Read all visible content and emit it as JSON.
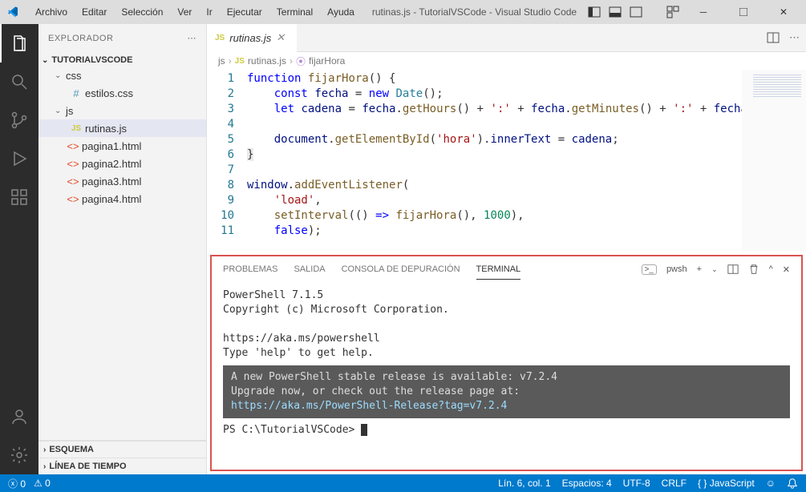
{
  "titlebar": {
    "menu": [
      "Archivo",
      "Editar",
      "Selección",
      "Ver",
      "Ir",
      "Ejecutar",
      "Terminal",
      "Ayuda"
    ],
    "title": "rutinas.js - TutorialVSCode - Visual Studio Code"
  },
  "sidebar": {
    "header": "EXPLORADOR",
    "project": "TUTORIALVSCODE",
    "folders": {
      "css": {
        "name": "css",
        "files": [
          "estilos.css"
        ]
      },
      "js": {
        "name": "js",
        "files": [
          "rutinas.js"
        ]
      }
    },
    "rootFiles": [
      "pagina1.html",
      "pagina2.html",
      "pagina3.html",
      "pagina4.html"
    ],
    "collapsed": [
      "ESQUEMA",
      "LÍNEA DE TIEMPO"
    ]
  },
  "tabs": {
    "active": {
      "icon": "JS",
      "name": "rutinas.js"
    }
  },
  "breadcrumbs": {
    "parts": [
      "js",
      "rutinas.js",
      "fijarHora"
    ],
    "icons": [
      "",
      "JS",
      "fn"
    ]
  },
  "code": {
    "lines": [
      1,
      2,
      3,
      4,
      5,
      6,
      7,
      8,
      9,
      10,
      11
    ]
  },
  "panel": {
    "tabs": [
      "PROBLEMAS",
      "SALIDA",
      "CONSOLA DE DEPURACIÓN",
      "TERMINAL"
    ],
    "active": "TERMINAL",
    "shell": "pwsh",
    "lines": {
      "l1": "PowerShell 7.1.5",
      "l2": "Copyright (c) Microsoft Corporation.",
      "l3": "https://aka.ms/powershell",
      "l4": "Type 'help' to get help.",
      "banner1": "A new PowerShell stable release is available: v7.2.4",
      "banner2": "Upgrade now, or check out the release page at:",
      "banner3": "  https://aka.ms/PowerShell-Release?tag=v7.2.4",
      "prompt": "PS C:\\TutorialVSCode> "
    }
  },
  "statusbar": {
    "errors": "0",
    "warnings": "0",
    "position": "Lín. 6, col. 1",
    "spaces": "Espacios: 4",
    "encoding": "UTF-8",
    "eol": "CRLF",
    "language": "JavaScript"
  }
}
